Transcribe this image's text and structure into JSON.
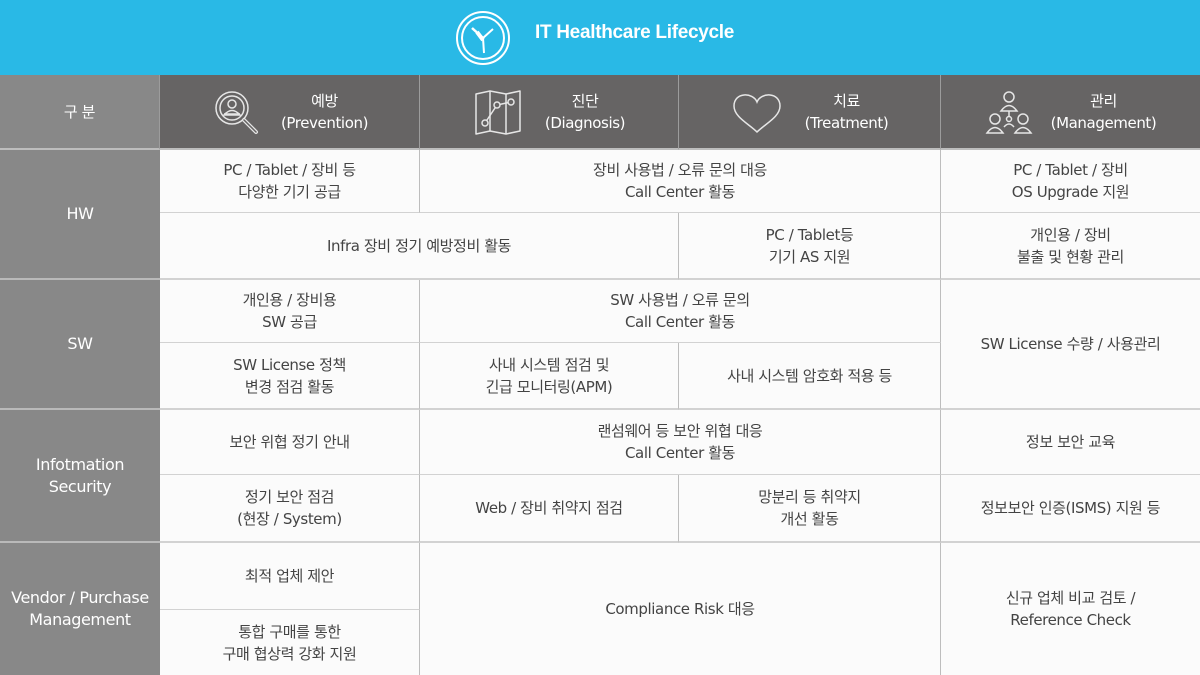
{
  "header": {
    "title": "IT Healthcare Lifecycle",
    "logo_icon": "clock-icon",
    "background_color": "#29b9e6"
  },
  "table": {
    "corner_label": "구 분",
    "columns": [
      {
        "ko": "예방",
        "en": "(Prevention)",
        "icon": "magnifier-person-icon"
      },
      {
        "ko": "진단",
        "en": "(Diagnosis)",
        "icon": "map-chart-icon"
      },
      {
        "ko": "치료",
        "en": "(Treatment)",
        "icon": "heart-icon"
      },
      {
        "ko": "관리",
        "en": "(Management)",
        "icon": "org-people-icon"
      }
    ],
    "categories": {
      "hw": "HW",
      "sw": "SW",
      "infosec": "Infotmation\nSecurity",
      "vendor": "Vendor / Purchase\nManagement"
    },
    "cells": {
      "hw_r1_prevention": "PC / Tablet / 장비 등\n다양한 기기 공급",
      "hw_r1_diag_treat": "장비 사용법 / 오류 문의 대응\nCall Center 활동",
      "hw_r1_management": "PC / Tablet / 장비\nOS Upgrade 지원",
      "hw_r2_prev_diag": "Infra 장비 정기 예방정비 활동",
      "hw_r2_treatment": "PC / Tablet등\n기기 AS 지원",
      "hw_r2_management": "개인용 / 장비\n불출 및 현황 관리",
      "sw_r1_prevention": "개인용 / 장비용\nSW 공급",
      "sw_r1_diag_treat": "SW 사용법 / 오류 문의\nCall Center 활동",
      "sw_management": "SW License 수량 / 사용관리",
      "sw_r2_prevention": "SW License 정책\n변경 점검 활동",
      "sw_r2_diagnosis": "사내 시스템 점검 및\n긴급 모니터링(APM)",
      "sw_r2_treatment": "사내 시스템 암호화 적용 등",
      "sec_r1_prevention": "보안 위협 정기 안내",
      "sec_r1_diag_treat": "랜섬웨어 등 보안 위협 대응\nCall Center 활동",
      "sec_r1_management": "정보 보안 교육",
      "sec_r2_prevention": "정기 보안 점검\n(현장 / System)",
      "sec_r2_diagnosis": "Web / 장비 취약지 점검",
      "sec_r2_treatment": "망분리 등 취약지\n개선 활동",
      "sec_r2_management": "정보보안 인증(ISMS) 지원 등",
      "ven_r1_prevention": "최적 업체 제안",
      "ven_diag_treat": "Compliance Risk 대응",
      "ven_management": "신규 업체 비교 검토 /\nReference Check",
      "ven_r2_prevention": "통합 구매를 통한\n구매 협상력 강화 지원"
    }
  }
}
